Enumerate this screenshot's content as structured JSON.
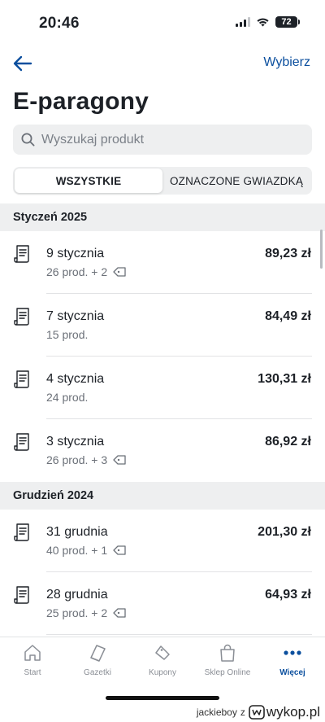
{
  "status": {
    "time": "20:46",
    "battery": "72"
  },
  "nav": {
    "select_label": "Wybierz"
  },
  "title": "E-paragony",
  "search": {
    "placeholder": "Wyszukaj produkt"
  },
  "segments": [
    {
      "label": "WSZYSTKIE",
      "active": true
    },
    {
      "label": "OZNACZONE GWIAZDKĄ",
      "active": false
    }
  ],
  "sections": [
    {
      "header": "Styczeń 2025",
      "receipts": [
        {
          "date": "9 stycznia",
          "meta": "26 prod. + 2",
          "coupon": true,
          "price": "89,23 zł"
        },
        {
          "date": "7 stycznia",
          "meta": "15 prod.",
          "coupon": false,
          "price": "84,49 zł"
        },
        {
          "date": "4 stycznia",
          "meta": "24 prod.",
          "coupon": false,
          "price": "130,31 zł"
        },
        {
          "date": "3 stycznia",
          "meta": "26 prod. + 3",
          "coupon": true,
          "price": "86,92 zł"
        }
      ]
    },
    {
      "header": "Grudzień 2024",
      "receipts": [
        {
          "date": "31 grudnia",
          "meta": "40 prod. + 1",
          "coupon": true,
          "price": "201,30 zł"
        },
        {
          "date": "28 grudnia",
          "meta": "25 prod. + 2",
          "coupon": true,
          "price": "64,93 zł"
        }
      ]
    }
  ],
  "tabs": [
    {
      "label": "Start",
      "icon": "home-icon",
      "active": false
    },
    {
      "label": "Gazetki",
      "icon": "leaflet-icon",
      "active": false
    },
    {
      "label": "Kupony",
      "icon": "coupon-icon",
      "active": false
    },
    {
      "label": "Sklep Online",
      "icon": "shopping-bag-icon",
      "active": false
    },
    {
      "label": "Więcej",
      "icon": "more-icon",
      "active": true
    }
  ],
  "watermark": {
    "user": "jackieboy",
    "separator": "z",
    "site": "wykop.pl"
  },
  "colors": {
    "accent": "#0b4f9e",
    "muted": "#6b7078",
    "section_bg": "#eeeff0"
  }
}
